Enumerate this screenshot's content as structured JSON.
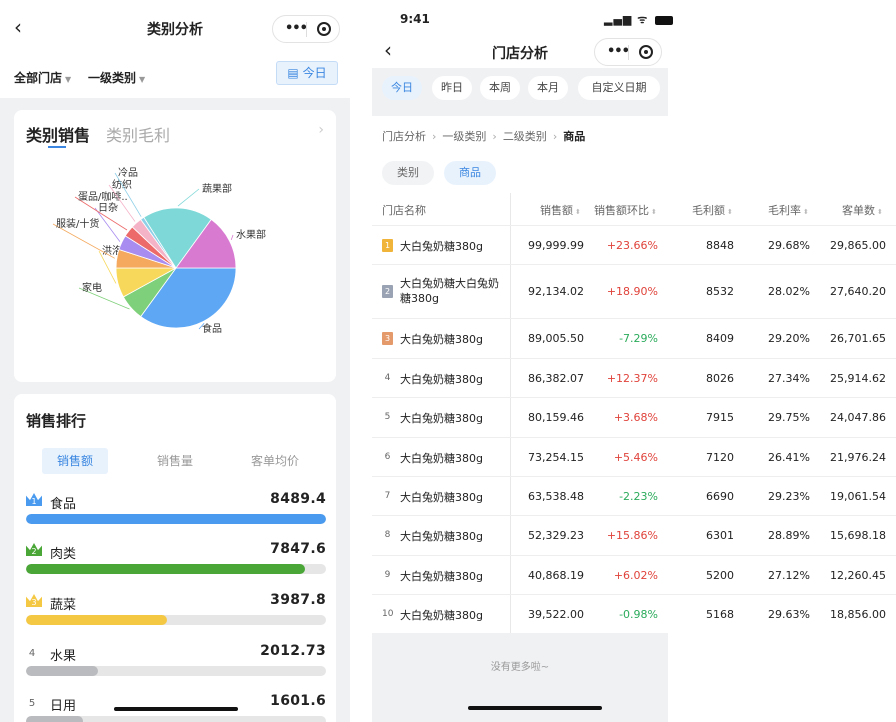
{
  "left": {
    "nav": {
      "back": "‹",
      "title": "类别分析"
    },
    "filters": {
      "store": "全部门店",
      "category": "一级类别",
      "today": "今日"
    },
    "sales_card": {
      "tab_active": "类别销售",
      "tab_other": "类别毛利",
      "arrow": "›",
      "pie_labels": [
        "食品",
        "家电",
        "洪洛",
        "服装/十货",
        "日杂",
        "蛋品/咖啡..",
        "纺织",
        "冷品",
        "蔬果部",
        "水果部"
      ]
    },
    "ranking": {
      "title": "销售排行",
      "tabs": [
        "销售额",
        "销售量",
        "客单均价"
      ],
      "items": [
        {
          "rank": "1",
          "name": "食品",
          "value": "8489.4",
          "ratio": 1.0,
          "color": "#4a9bef",
          "badge_color": "#4a9bef"
        },
        {
          "rank": "2",
          "name": "肉类",
          "value": "7847.6",
          "ratio": 0.93,
          "color": "#4aa637",
          "badge_color": "#4aa637"
        },
        {
          "rank": "3",
          "name": "蔬菜",
          "value": "3987.8",
          "ratio": 0.47,
          "color": "#f5c844",
          "badge_color": "#f5c844"
        },
        {
          "rank": "4",
          "name": "水果",
          "value": "2012.73",
          "ratio": 0.24,
          "color": "#b9bbbe",
          "badge_color": ""
        },
        {
          "rank": "5",
          "name": "日用",
          "value": "1601.6",
          "ratio": 0.19,
          "color": "#b9bbbe",
          "badge_color": ""
        }
      ]
    },
    "chart_data": {
      "type": "pie",
      "categories": [
        "食品",
        "家电",
        "洪洛",
        "服装/十货",
        "日杂",
        "蛋品/咖啡..",
        "纺织",
        "冷品",
        "蔬果部",
        "水果部"
      ],
      "values": [
        35,
        7,
        8,
        5,
        4,
        3,
        3,
        1,
        19,
        15
      ],
      "colors": [
        "#5da7f5",
        "#7fd07a",
        "#f7d85a",
        "#f4a95e",
        "#a98cf0",
        "#ec6a6a",
        "#f5b3c8",
        "#8fd0e8",
        "#7fd8d8",
        "#d97ad1"
      ]
    }
  },
  "right": {
    "status": {
      "time": "9:41",
      "icons": "▂▄▆ ᯤ"
    },
    "nav": {
      "back": "‹",
      "title": "门店分析"
    },
    "date_chips": [
      "今日",
      "昨日",
      "本周",
      "本月",
      "自定义日期"
    ],
    "breadcrumb": [
      "门店分析",
      "一级类别",
      "二级类别",
      "商品"
    ],
    "segments": [
      "类别",
      "商品"
    ],
    "columns": [
      "门店名称",
      "销售额",
      "销售额环比",
      "毛利额",
      "毛利率",
      "客单数"
    ],
    "rows": [
      {
        "rank": "1",
        "name": "大白兔奶糖380g",
        "sales": "99,999.99",
        "mom": "+23.66%",
        "profit": "8848",
        "rate": "29.68%",
        "orders": "29,865.00",
        "dir": "up"
      },
      {
        "rank": "2",
        "name": "大白兔奶糖大白兔奶糖380g",
        "sales": "92,134.02",
        "mom": "+18.90%",
        "profit": "8532",
        "rate": "28.02%",
        "orders": "27,640.20",
        "dir": "up"
      },
      {
        "rank": "3",
        "name": "大白兔奶糖380g",
        "sales": "89,005.50",
        "mom": "-7.29%",
        "profit": "8409",
        "rate": "29.20%",
        "orders": "26,701.65",
        "dir": "down"
      },
      {
        "rank": "4",
        "name": "大白兔奶糖380g",
        "sales": "86,382.07",
        "mom": "+12.37%",
        "profit": "8026",
        "rate": "27.34%",
        "orders": "25,914.62",
        "dir": "up"
      },
      {
        "rank": "5",
        "name": "大白兔奶糖380g",
        "sales": "80,159.46",
        "mom": "+3.68%",
        "profit": "7915",
        "rate": "29.75%",
        "orders": "24,047.86",
        "dir": "up"
      },
      {
        "rank": "6",
        "name": "大白兔奶糖380g",
        "sales": "73,254.15",
        "mom": "+5.46%",
        "profit": "7120",
        "rate": "26.41%",
        "orders": "21,976.24",
        "dir": "up"
      },
      {
        "rank": "7",
        "name": "大白兔奶糖380g",
        "sales": "63,538.48",
        "mom": "-2.23%",
        "profit": "6690",
        "rate": "29.23%",
        "orders": "19,061.54",
        "dir": "down"
      },
      {
        "rank": "8",
        "name": "大白兔奶糖380g",
        "sales": "52,329.23",
        "mom": "+15.86%",
        "profit": "6301",
        "rate": "28.89%",
        "orders": "15,698.18",
        "dir": "up"
      },
      {
        "rank": "9",
        "name": "大白兔奶糖380g",
        "sales": "40,868.19",
        "mom": "+6.02%",
        "profit": "5200",
        "rate": "27.12%",
        "orders": "12,260.45",
        "dir": "up"
      },
      {
        "rank": "10",
        "name": "大白兔奶糖380g",
        "sales": "39,522.00",
        "mom": "-0.98%",
        "profit": "5168",
        "rate": "29.63%",
        "orders": "18,856.00",
        "dir": "down"
      }
    ],
    "footer": "没有更多啦~",
    "medal_colors": [
      "#f0b43a",
      "#9aa3b3",
      "#e59a6b"
    ]
  }
}
